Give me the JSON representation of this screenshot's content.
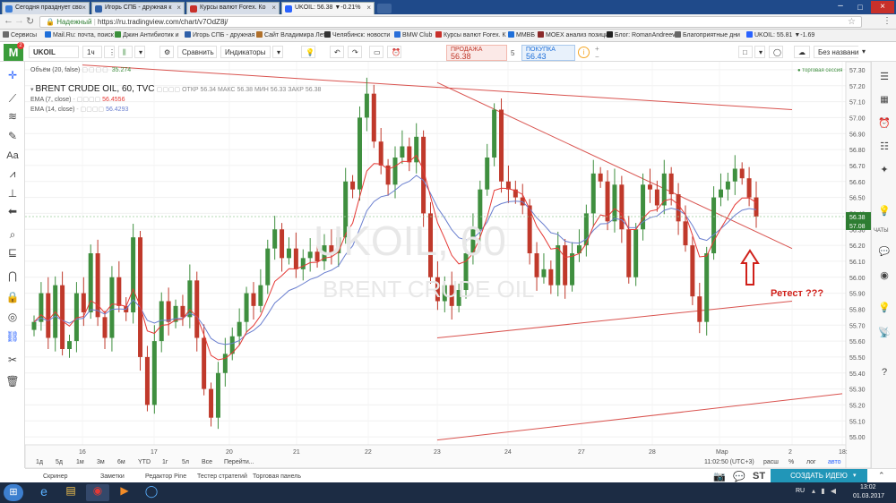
{
  "browser": {
    "tabs": [
      {
        "label": "Сегодня празднует сво",
        "color": "#3b7dd8"
      },
      {
        "label": "Игорь СПБ - дружная к",
        "color": "#2e5fa8"
      },
      {
        "label": "Курсы валют Forex. Ко",
        "color": "#c8302a"
      },
      {
        "label": "UKOIL: 56.38 ▼-0.21%",
        "color": "#2962ff"
      }
    ],
    "secure_label": "Надежный",
    "url": "https://ru.tradingview.com/chart/v7OdZ8j/",
    "bookmarks": [
      {
        "label": "Сервисы",
        "color": "#6a6a6a"
      },
      {
        "label": "Mail.Ru: почта, поиск",
        "color": "#1e6fd9"
      },
      {
        "label": "Джин Антибиотик и",
        "color": "#3a8f3a"
      },
      {
        "label": "Игорь СПБ - дружная",
        "color": "#2e5fa8"
      },
      {
        "label": "Сайт Владимира Лет",
        "color": "#b0702a"
      },
      {
        "label": "Челябинск: новости",
        "color": "#333333"
      },
      {
        "label": "BMW Club",
        "color": "#2a6fd9"
      },
      {
        "label": "Курсы валют Forex. К",
        "color": "#c8302a"
      },
      {
        "label": "ММВБ",
        "color": "#1e6fd9"
      },
      {
        "label": "MOEX анализ позиций",
        "color": "#8b2a2a"
      },
      {
        "label": "Блог: RomanAndreev",
        "color": "#222222"
      },
      {
        "label": "Благоприятные дни",
        "color": "#666666"
      },
      {
        "label": "UKOIL: 55.81 ▼-1.69",
        "color": "#2962ff"
      }
    ]
  },
  "toolbar": {
    "symbol": "UKOIL",
    "interval": "1ч",
    "compare_label": "Сравнить",
    "indicators_label": "Индикаторы",
    "layout_name": "Без названия",
    "sell_label": "ПРОДАЖА",
    "sell_price": "56.38",
    "spread": "5",
    "buy_label": "ПОКУПКА",
    "buy_price": "56.43"
  },
  "chart_header": {
    "volume_label": "Объём (20, false)",
    "volume_value": "35.274",
    "title": "BRENT CRUDE OIL, 60, TVC",
    "ohlc": "ОТКР 56.34 МАКС 56.38 МИН 56.33 ЗАКР 56.38",
    "ema7_label": "EMA (7, close)",
    "ema7_value": "56.4556",
    "ema14_label": "EMA (14, close)",
    "ema14_value": "56.4293",
    "session_label": "торговая сессия"
  },
  "watermark": {
    "line1": "UKOIL, 60",
    "line2": "BRENT CRUDE OIL"
  },
  "annotation": {
    "text": "Ретест ???",
    "color": "#d0201a"
  },
  "chart_data": {
    "type": "candlestick",
    "symbol": "UKOIL",
    "interval": "60",
    "last_price": 56.38,
    "ylim": [
      54.95,
      57.35
    ],
    "y_ticks": [
      "57.30",
      "57.20",
      "57.10",
      "57.00",
      "56.90",
      "56.80",
      "56.70",
      "56.60",
      "56.50",
      "56.40",
      "56.30",
      "56.20",
      "56.10",
      "56.00",
      "55.90",
      "55.80",
      "55.70",
      "55.60",
      "55.50",
      "55.40",
      "55.30",
      "55.20",
      "55.10",
      "55.00"
    ],
    "price_labels": [
      {
        "value": "56.38",
        "color": "#2e7d32"
      },
      {
        "value": "57.08",
        "color": "#2e7d32"
      }
    ],
    "x_ticks": [
      "16",
      "17",
      "20",
      "21",
      "22",
      "23",
      "24",
      "27",
      "28",
      "Мар",
      "2",
      "18:"
    ],
    "colors": {
      "up": "#3f8f3f",
      "down": "#c0392b",
      "ema7": "#e53935",
      "ema14": "#6a7fcf",
      "trendline": "#d9534f"
    },
    "series": [
      {
        "name": "price",
        "values": [
          55.72,
          55.9,
          55.62,
          55.95,
          55.55,
          55.6,
          55.9,
          55.78,
          56.15,
          55.75,
          55.62,
          56.0,
          55.82,
          55.78,
          56.25,
          55.5,
          55.2,
          55.6,
          55.85,
          55.72,
          55.82,
          55.75,
          55.98,
          55.62,
          55.3,
          55.12,
          55.4,
          55.52,
          55.63,
          55.72,
          55.9,
          55.82,
          55.95,
          56.18,
          56.3,
          56.12,
          56.18,
          56.05,
          56.12,
          56.16,
          56.1,
          56.2,
          56.15,
          56.25,
          56.6,
          56.55,
          57.0,
          57.15,
          56.85,
          56.7,
          56.58,
          56.75,
          56.82,
          56.72,
          56.88,
          56.4,
          56.0,
          55.85,
          55.95,
          55.82,
          55.92,
          56.15,
          56.3,
          56.55,
          56.75,
          57.05,
          56.6,
          56.55,
          56.5,
          56.45,
          56.15,
          56.0,
          56.05,
          55.95,
          56.2,
          55.95,
          56.15,
          56.2,
          56.4,
          56.65,
          56.6,
          56.35,
          56.58,
          56.3,
          56.0,
          56.3,
          56.58,
          56.55,
          56.45,
          56.65,
          56.52,
          56.35,
          56.2,
          55.88,
          55.72,
          56.15,
          56.5,
          56.55,
          56.6,
          56.68,
          56.62,
          56.5,
          56.38
        ]
      },
      {
        "name": "EMA (7, close)"
      },
      {
        "name": "EMA (14, close)"
      }
    ],
    "trendlines": [
      {
        "from": [
          "16",
          57.33
        ],
        "to": [
          "2",
          57.05
        ]
      },
      {
        "from": [
          "23",
          57.22
        ],
        "to": [
          "2",
          56.18
        ]
      },
      {
        "from": [
          "23",
          55.62
        ],
        "to": [
          "2",
          55.85
        ]
      },
      {
        "from": [
          "23",
          54.98
        ],
        "to": [
          "18:",
          55.27
        ]
      }
    ],
    "volume": 35.274
  },
  "bottom_bar": {
    "ranges": [
      "1д",
      "5д",
      "1м",
      "3м",
      "6м",
      "YTD",
      "1г",
      "5л",
      "Все",
      "Перейти..."
    ],
    "time": "11:02:50 (UTC+3)",
    "scale_opts": [
      "расш",
      "%",
      "лог",
      "авто"
    ],
    "tabs": [
      "Скринер",
      "Заметки",
      "Редактор Pine",
      "Тестер стратегий",
      "Торговая панель"
    ],
    "publish_label": "СОЗДАТЬ ИДЕЮ",
    "st_label": "ST"
  },
  "right_sidebar": {
    "chats_label": "ЧАТЫ"
  },
  "taskbar": {
    "lang": "RU",
    "clock": "13:02",
    "date": "01.03.2017"
  }
}
